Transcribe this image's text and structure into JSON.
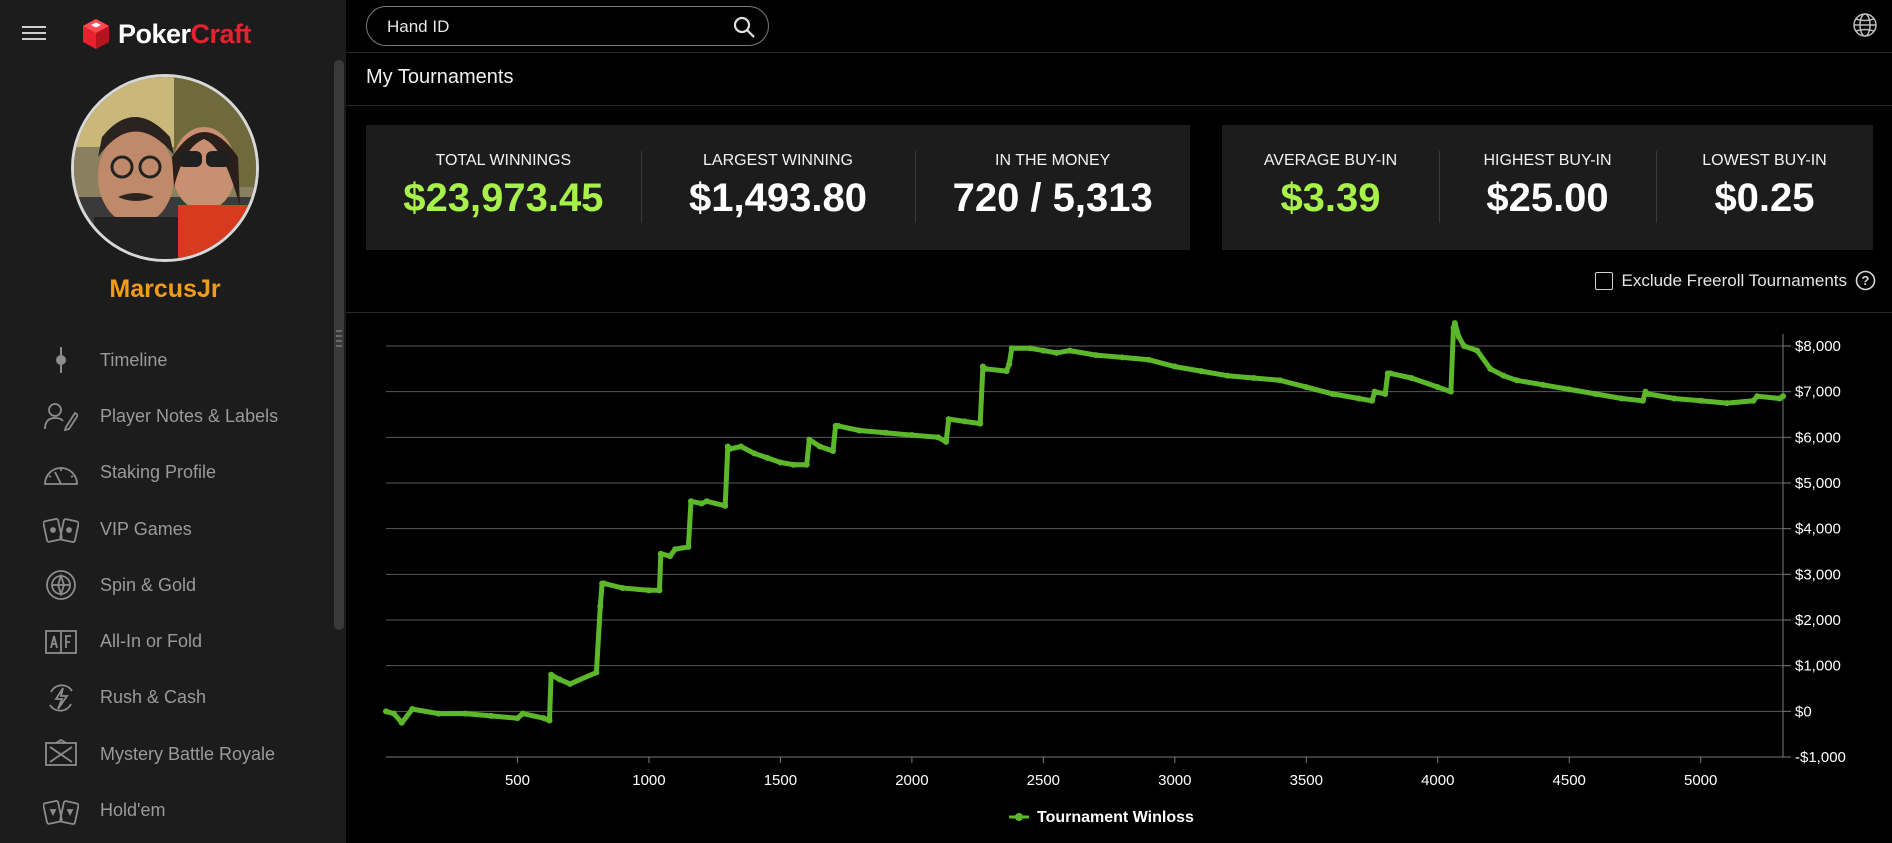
{
  "app": {
    "logo_part1": "Poker",
    "logo_part2": "Craft"
  },
  "search": {
    "placeholder": "Hand ID"
  },
  "profile": {
    "username": "MarcusJr"
  },
  "sidebar": {
    "items": [
      {
        "label": "Timeline",
        "icon": "timeline-icon"
      },
      {
        "label": "Player Notes & Labels",
        "icon": "notes-icon"
      },
      {
        "label": "Staking Profile",
        "icon": "gauge-icon"
      },
      {
        "label": "VIP Games",
        "icon": "cards-icon"
      },
      {
        "label": "Spin & Gold",
        "icon": "spin-icon"
      },
      {
        "label": "All-In or Fold",
        "icon": "allin-icon"
      },
      {
        "label": "Rush & Cash",
        "icon": "rush-icon"
      },
      {
        "label": "Mystery Battle Royale",
        "icon": "battle-icon"
      },
      {
        "label": "Hold'em",
        "icon": "holdem-icon"
      }
    ]
  },
  "main": {
    "title": "My Tournaments"
  },
  "stats": {
    "total_winnings": {
      "label": "TOTAL WINNINGS",
      "value": "$23,973.45"
    },
    "largest_winning": {
      "label": "LARGEST WINNING",
      "value": "$1,493.80"
    },
    "in_the_money": {
      "label": "IN THE MONEY",
      "value": "720 / 5,313"
    },
    "average_buyin": {
      "label": "AVERAGE BUY-IN",
      "value": "$3.39"
    },
    "highest_buyin": {
      "label": "HIGHEST BUY-IN",
      "value": "$25.00"
    },
    "lowest_buyin": {
      "label": "LOWEST BUY-IN",
      "value": "$0.25"
    }
  },
  "filters": {
    "exclude_freeroll_label": "Exclude Freeroll Tournaments",
    "exclude_freeroll_checked": false
  },
  "colors": {
    "accent_green": "#a8f04a",
    "line_green": "#5cb82a",
    "brand_red": "#e8212e",
    "username_orange": "#f29b1a"
  },
  "chart_data": {
    "type": "line",
    "xlim": [
      0,
      5313
    ],
    "ylim": [
      -1000,
      8000
    ],
    "x_ticks": [
      500,
      1000,
      1500,
      2000,
      2500,
      3000,
      3500,
      4000,
      4500,
      5000
    ],
    "y_ticks": [
      -1000,
      0,
      1000,
      2000,
      3000,
      4000,
      5000,
      6000,
      7000,
      8000
    ],
    "y_tick_labels": [
      "-$1,000",
      "$0",
      "$1,000",
      "$2,000",
      "$3,000",
      "$4,000",
      "$5,000",
      "$6,000",
      "$7,000",
      "$8,000"
    ],
    "x_tick_labels": [
      "500",
      "1000",
      "1500",
      "2000",
      "2500",
      "3000",
      "3500",
      "4000",
      "4500",
      "5000"
    ],
    "grid": true,
    "legend_position": "bottom",
    "series": [
      {
        "name": "Tournament Winloss",
        "x": [
          0,
          30,
          60,
          100,
          200,
          300,
          400,
          500,
          520,
          600,
          622,
          628,
          660,
          700,
          800,
          815,
          822,
          830,
          900,
          1000,
          1040,
          1045,
          1080,
          1100,
          1150,
          1160,
          1200,
          1220,
          1290,
          1300,
          1310,
          1350,
          1400,
          1450,
          1500,
          1550,
          1600,
          1610,
          1650,
          1700,
          1710,
          1720,
          1800,
          1900,
          2000,
          2100,
          2130,
          2140,
          2200,
          2260,
          2270,
          2280,
          2360,
          2370,
          2380,
          2450,
          2500,
          2550,
          2600,
          2700,
          2800,
          2900,
          3000,
          3100,
          3200,
          3300,
          3400,
          3500,
          3600,
          3700,
          3750,
          3760,
          3800,
          3810,
          3820,
          3900,
          4000,
          4050,
          4060,
          4065,
          4080,
          4100,
          4150,
          4200,
          4250,
          4300,
          4400,
          4500,
          4600,
          4700,
          4780,
          4790,
          4800,
          4900,
          5000,
          5100,
          5200,
          5215,
          5300,
          5313
        ],
        "values": [
          0,
          -50,
          -250,
          50,
          -50,
          -50,
          -100,
          -150,
          -50,
          -150,
          -200,
          800,
          700,
          600,
          850,
          2300,
          2800,
          2800,
          2700,
          2650,
          2650,
          3450,
          3400,
          3550,
          3600,
          4600,
          4550,
          4600,
          4500,
          5800,
          5750,
          5800,
          5650,
          5550,
          5450,
          5400,
          5400,
          5950,
          5800,
          5700,
          6250,
          6250,
          6150,
          6100,
          6050,
          6000,
          5900,
          6400,
          6350,
          6300,
          7550,
          7500,
          7450,
          7600,
          7950,
          7950,
          7900,
          7850,
          7900,
          7800,
          7750,
          7700,
          7550,
          7450,
          7350,
          7300,
          7250,
          7100,
          6950,
          6850,
          6800,
          7000,
          6950,
          7400,
          7400,
          7300,
          7100,
          7000,
          8400,
          8500,
          8200,
          8000,
          7900,
          7500,
          7350,
          7250,
          7150,
          7050,
          6950,
          6850,
          6800,
          7000,
          6950,
          6850,
          6800,
          6750,
          6800,
          6900,
          6850,
          6900
        ]
      }
    ]
  }
}
